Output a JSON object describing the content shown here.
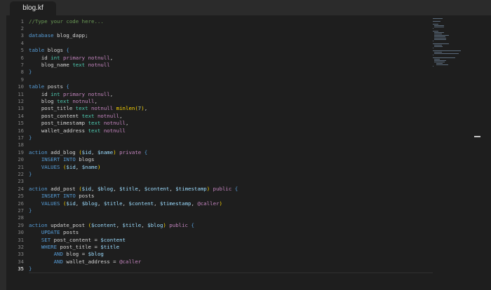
{
  "tab": {
    "title": "blog.kf"
  },
  "active_line": 35,
  "colors": {
    "background": "#1e1e1e",
    "keyword_blue": "#569cd6",
    "keyword_pink": "#c586c0",
    "type_teal": "#4ec9b0",
    "identifier": "#9cdcfe",
    "comment": "#6a9955",
    "number": "#b5cea8",
    "brace": "#ffd700"
  },
  "code": {
    "lines": [
      "//Type your code here...",
      "",
      "database blog_dapp;",
      "",
      "table blogs {",
      "    id int primary notnull,",
      "    blog_name text notnull",
      "}",
      "",
      "table posts {",
      "    id int primary notnull,",
      "    blog text notnull,",
      "    post_title text notnull minlen(7),",
      "    post_content text notnull,",
      "    post_timestamp text notnull,",
      "    wallet_address text notnull",
      "}",
      "",
      "action add_blog ($id, $name) private {",
      "    INSERT INTO blogs",
      "    VALUES ($id, $name)",
      "}",
      "",
      "action add_post ($id, $blog, $title, $content, $timestamp) public {",
      "    INSERT INTO posts",
      "    VALUES ($id, $blog, $title, $content, $timestamp, @caller)",
      "}",
      "",
      "action update_post ($content, $title, $blog) public {",
      "    UPDATE posts",
      "    SET post_content = $content",
      "    WHERE post_title = $title",
      "        AND blog = $blog",
      "        AND wallet_address = @caller",
      "}"
    ]
  }
}
